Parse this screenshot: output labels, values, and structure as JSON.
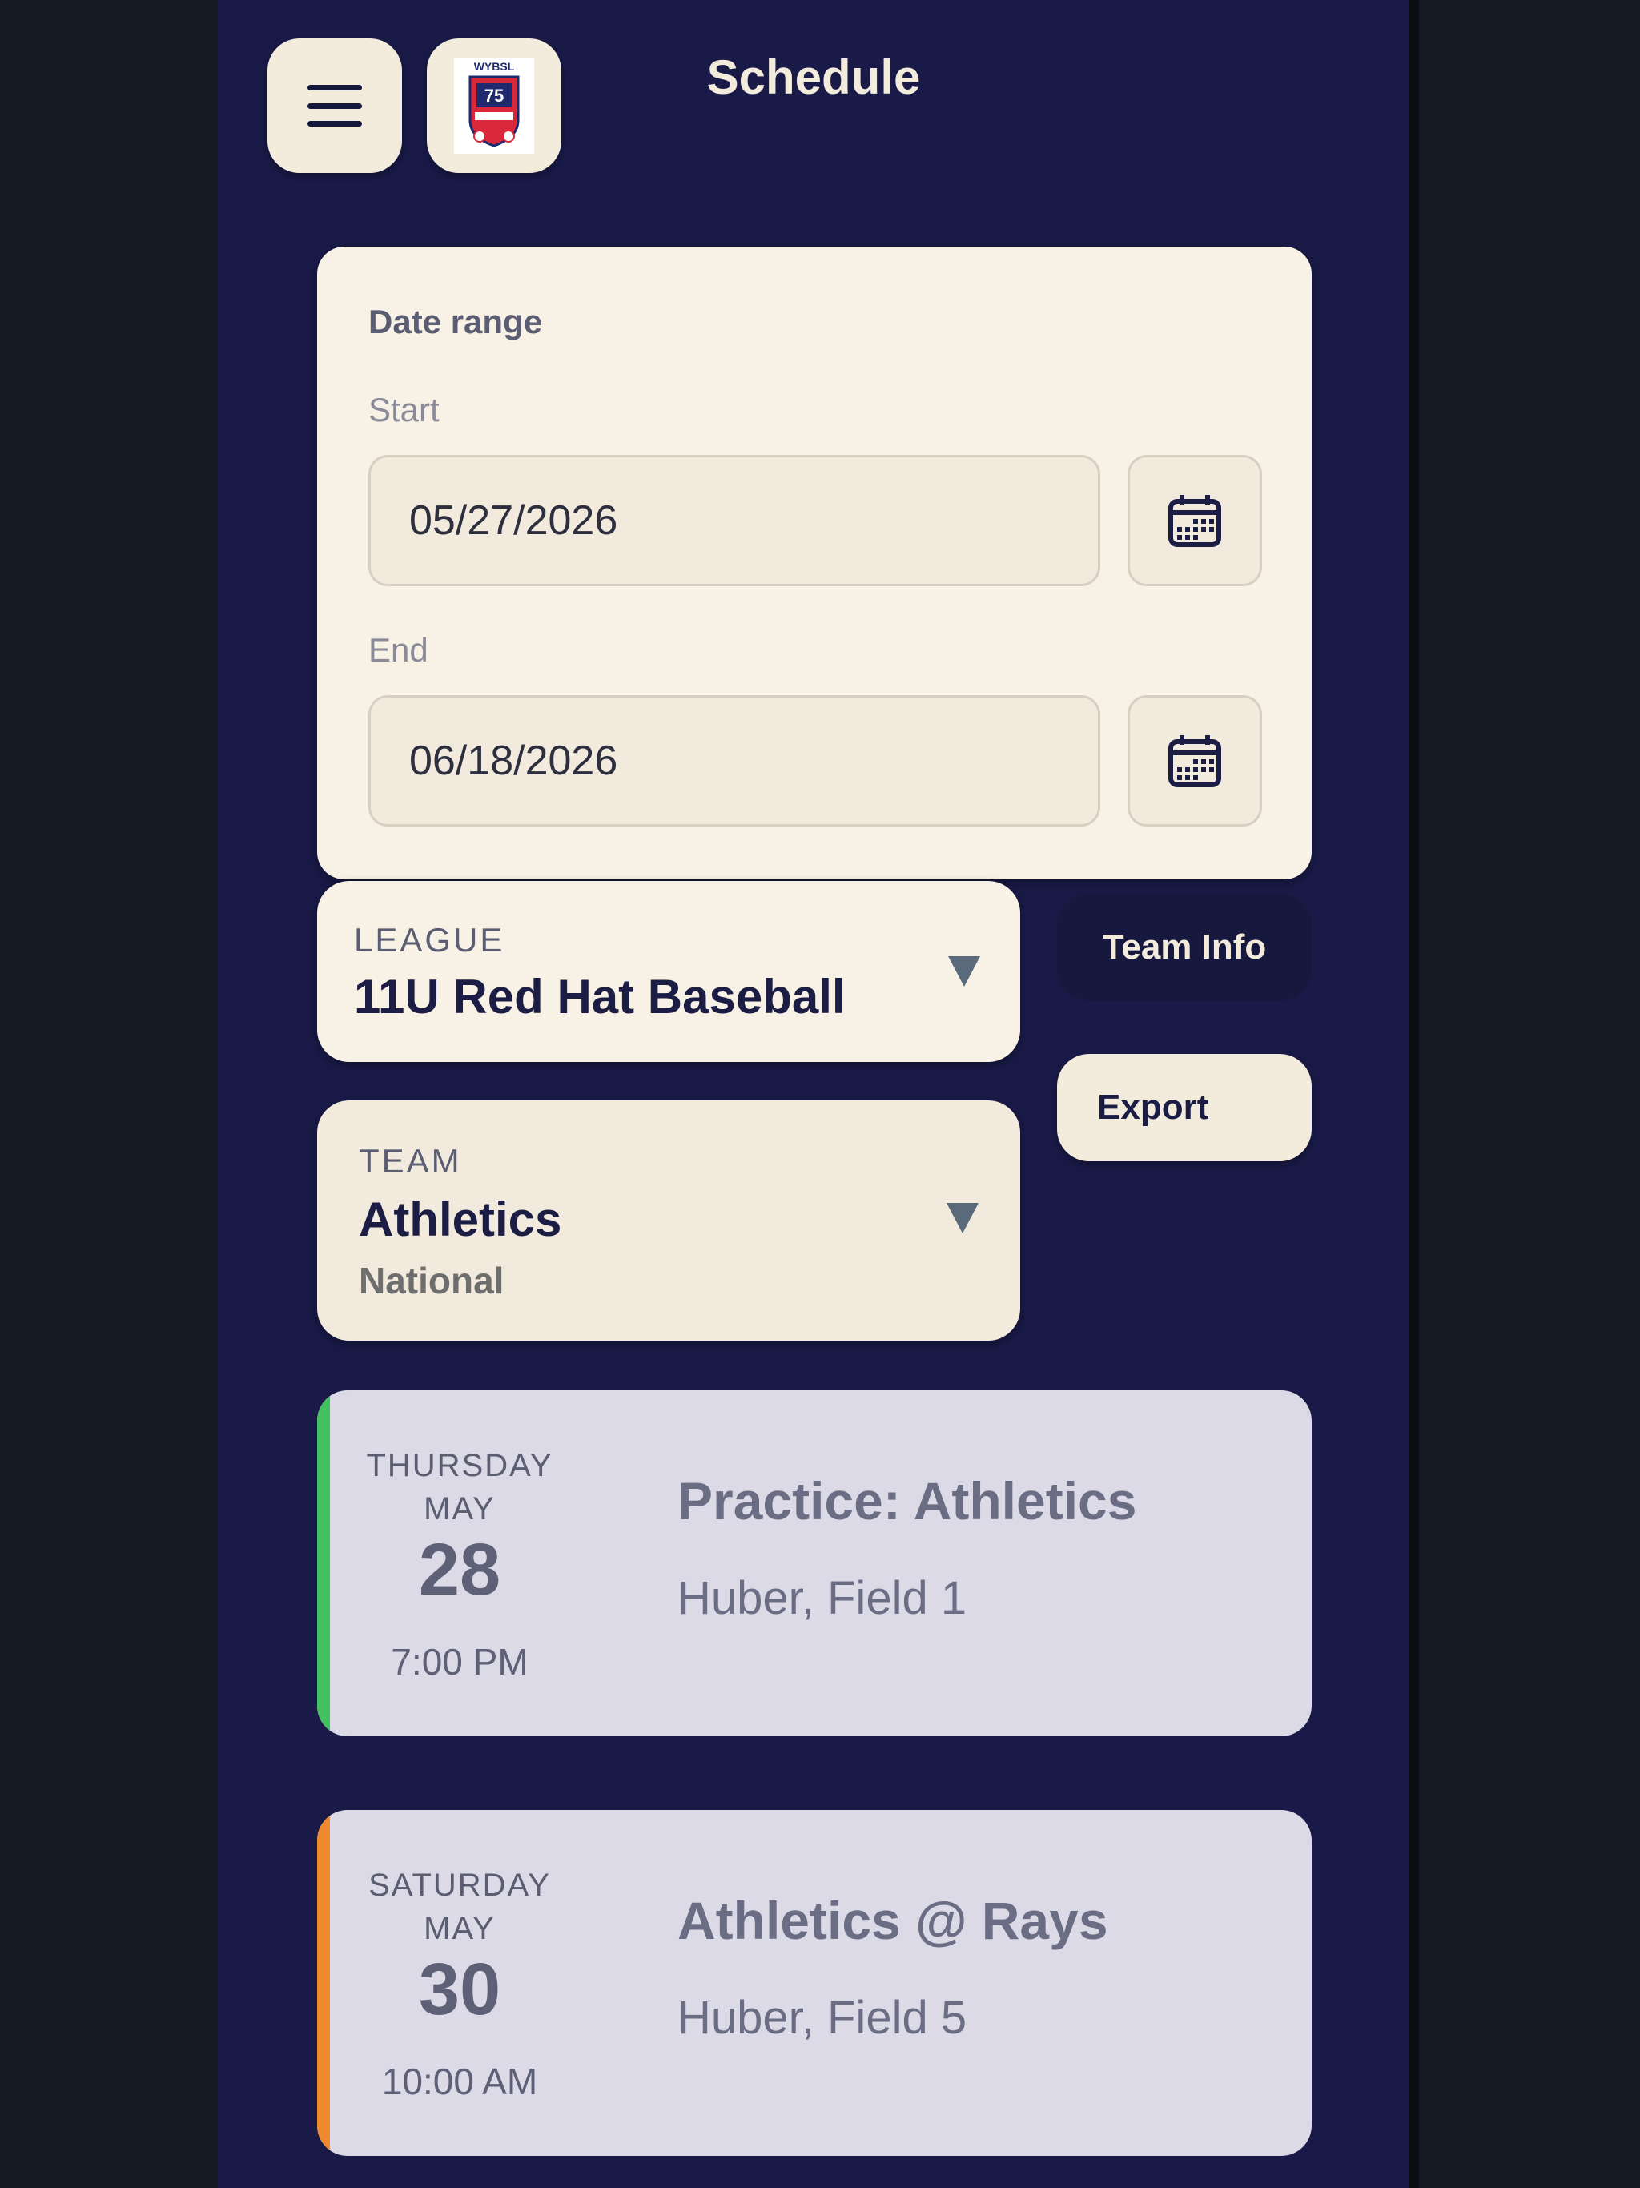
{
  "header": {
    "title": "Schedule",
    "menu_icon": "hamburger-menu-icon",
    "logo": {
      "top_text": "WYBSL",
      "badge_text": "75"
    }
  },
  "date_range": {
    "title": "Date range",
    "start_label": "Start",
    "start_value": "05/27/2026",
    "end_label": "End",
    "end_value": "06/18/2026",
    "calendar_icon": "calendar-icon"
  },
  "league": {
    "label": "LEAGUE",
    "value": "11U Red Hat Baseball"
  },
  "team": {
    "label": "TEAM",
    "value": "Athletics",
    "division": "National"
  },
  "actions": {
    "team_info": "Team Info",
    "export": "Export"
  },
  "events": [
    {
      "weekday": "THURSDAY",
      "month": "MAY",
      "day": "28",
      "time": "7:00 PM",
      "title": "Practice: Athletics",
      "location": "Huber, Field 1",
      "accent": "#3fc25f"
    },
    {
      "weekday": "SATURDAY",
      "month": "MAY",
      "day": "30",
      "time": "10:00 AM",
      "title": "Athletics @ Rays",
      "location": "Huber, Field 5",
      "accent": "#f08a2c"
    }
  ],
  "colors": {
    "background": "#191a47",
    "card": "#f7f1e6",
    "event_card": "#dcdae6",
    "text_dark": "#1b1d45"
  }
}
